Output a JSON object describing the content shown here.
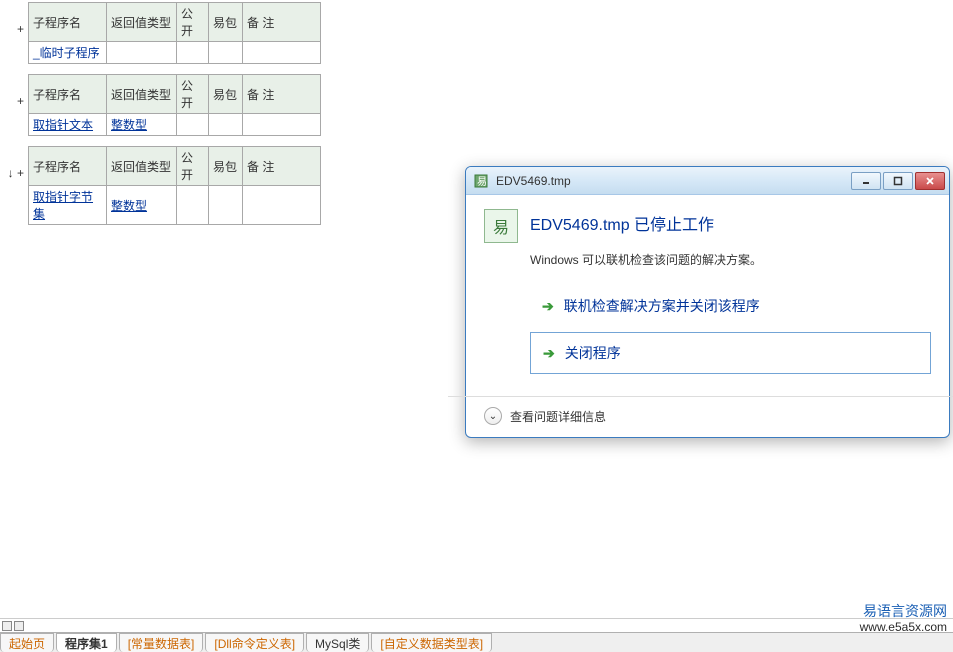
{
  "headers": {
    "name": "子程序名",
    "ret": "返回值类型",
    "pub": "公开",
    "easy": "易包",
    "note": "备 注"
  },
  "tables": [
    {
      "plus": "+",
      "name": "_临时子程序",
      "ret": ""
    },
    {
      "plus": "+",
      "name": "取指针文本",
      "ret": "整数型"
    },
    {
      "plus": "↓ +",
      "name": "取指针字节集",
      "ret": "整数型"
    }
  ],
  "dialog": {
    "window_title": "EDV5469.tmp",
    "title": "EDV5469.tmp 已停止工作",
    "subtitle": "Windows 可以联机检查该问题的解决方案。",
    "opt1": "联机检查解决方案并关闭该程序",
    "opt2": "关闭程序",
    "details": "查看问题详细信息",
    "app_glyph": "易"
  },
  "tabs": {
    "t0": "起始页",
    "t1": "程序集1",
    "t2": "[常量数据表]",
    "t3": "[Dll命令定义表]",
    "t4": "MySql类",
    "t5": "[自定义数据类型表]"
  },
  "watermark": {
    "cn": "易语言资源网",
    "url": "www.e5a5x.com"
  }
}
